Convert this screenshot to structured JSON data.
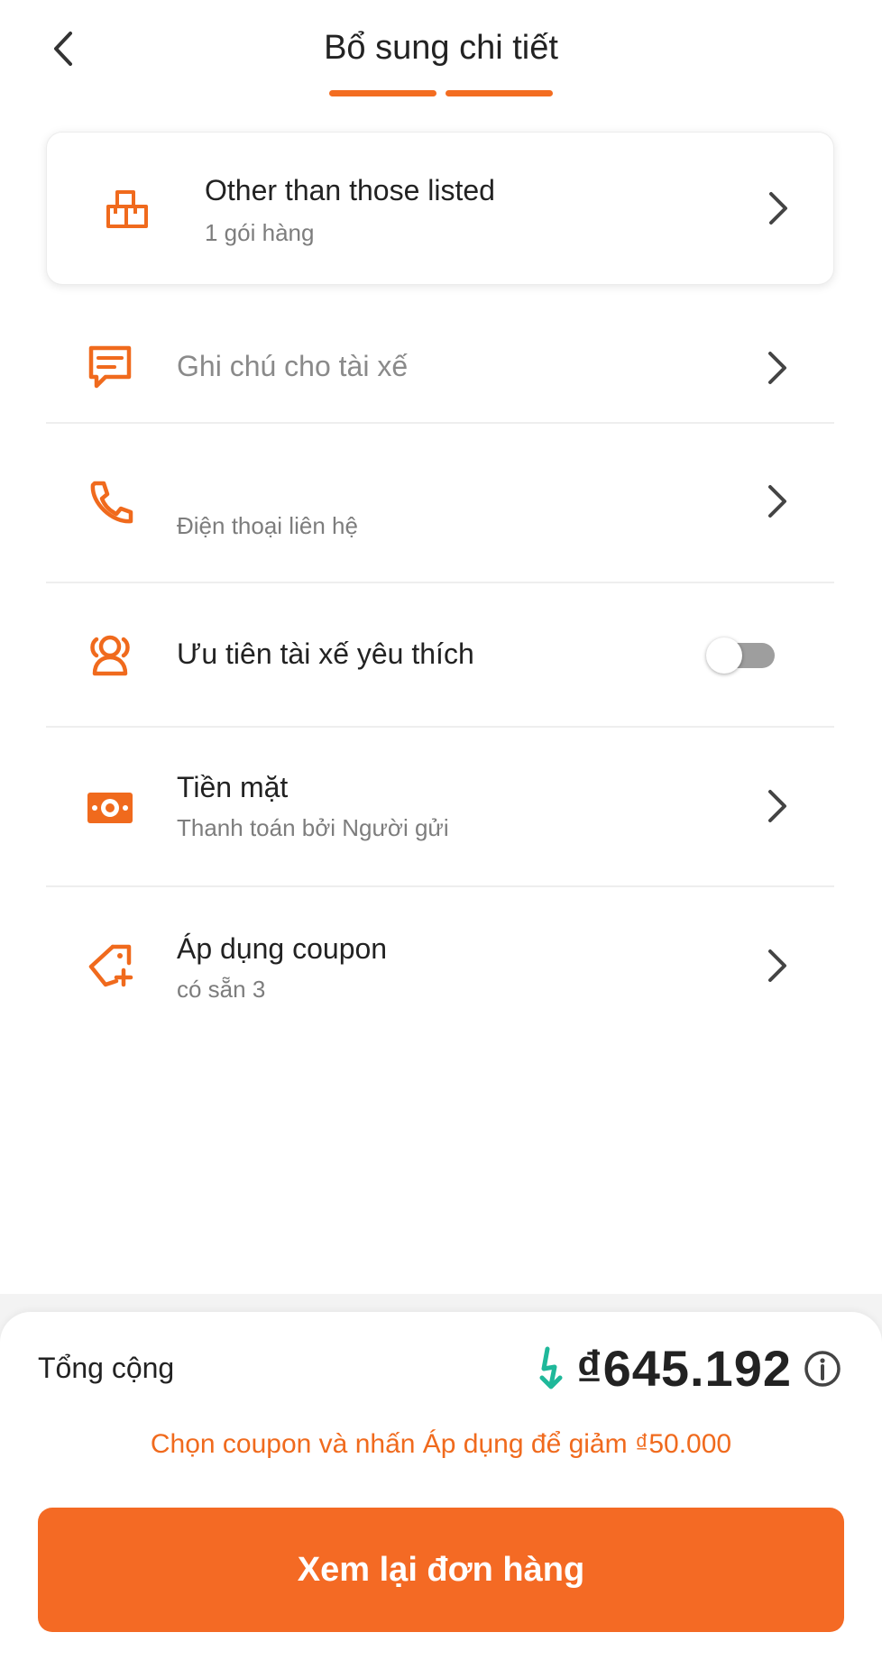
{
  "header": {
    "title": "Bổ sung chi tiết",
    "back_icon": "chevron-left-icon",
    "steps": 2
  },
  "cargo": {
    "title": "Other than those listed",
    "subtitle": "1 gói hàng",
    "icon": "boxes-icon"
  },
  "rows": {
    "note": {
      "placeholder": "Ghi chú cho tài xế",
      "icon": "message-icon"
    },
    "phone": {
      "sublabel": "Điện thoại liên hệ",
      "icon": "phone-icon"
    },
    "favorite": {
      "label": "Ưu tiên tài xế yêu thích",
      "icon": "people-icon",
      "toggle_on": false
    },
    "payment": {
      "label": "Tiền mặt",
      "sublabel": "Thanh toán bởi Người gửi",
      "icon": "cash-icon"
    },
    "coupon": {
      "label": "Áp dụng coupon",
      "sublabel": "có sẵn 3",
      "icon": "coupon-tag-icon"
    }
  },
  "footer": {
    "total_label": "Tổng cộng",
    "total_amount": "₫645.192",
    "hint": "Chọn coupon và nhấn Áp dụng để giảm ₫50.000",
    "cta_label": "Xem lại đơn hàng"
  },
  "colors": {
    "accent": "#f36d21",
    "discount_icon": "#1fb89a",
    "toggle_off": "#9e9e9e"
  }
}
